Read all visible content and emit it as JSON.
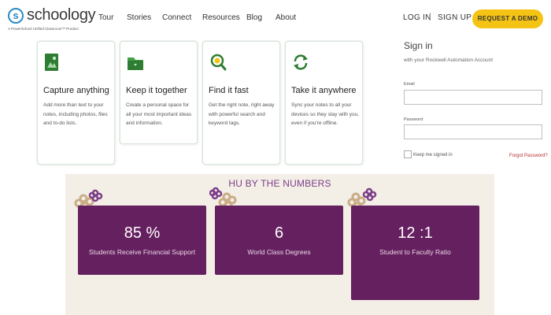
{
  "brand": {
    "name": "schoology",
    "tagline": "A PowerSchool Unified Classroom™ Product",
    "accent": "#2a8bc6"
  },
  "nav": {
    "links": [
      "Tour",
      "Stories",
      "Connect",
      "Resources",
      "Blog",
      "About"
    ],
    "login": "LOG IN",
    "separator": "|",
    "signup": "SIGN UP",
    "demo": "REQUEST A DEMO",
    "demo_color": "#f4c314"
  },
  "features": [
    {
      "title": "Capture anything",
      "text": "Add more than text to your notes, including photos, files and to-do lists.",
      "icon": "note-image-icon"
    },
    {
      "title": "Keep it together",
      "text": "Create a personal space for all your most important ideas and information.",
      "icon": "folder-icon"
    },
    {
      "title": "Find it fast",
      "text": "Get the right note, right away with powerful search and keyword tags.",
      "icon": "search-icon"
    },
    {
      "title": "Take it anywhere",
      "text": "Sync your notes to all your devices so they stay with you, even if you're offline.",
      "icon": "sync-icon"
    }
  ],
  "signin": {
    "title": "Sign in",
    "subtitle": "with your Rockwell Automation Account",
    "email_label": "Email",
    "email_value": "",
    "password_label": "Password",
    "password_value": "",
    "keep_label": "Keep me signed in",
    "forgot": "Forgot Password?"
  },
  "numbers": {
    "title": "HU BY THE NUMBERS",
    "stats": [
      {
        "value": "85 %",
        "label": "Students Receive Financial Support"
      },
      {
        "value": "6",
        "label": "World Class Degrees"
      },
      {
        "value": "12 :1",
        "label": "Student to Faculty Ratio"
      }
    ],
    "panel_color": "#65205f",
    "band_color": "#f3eee6"
  }
}
